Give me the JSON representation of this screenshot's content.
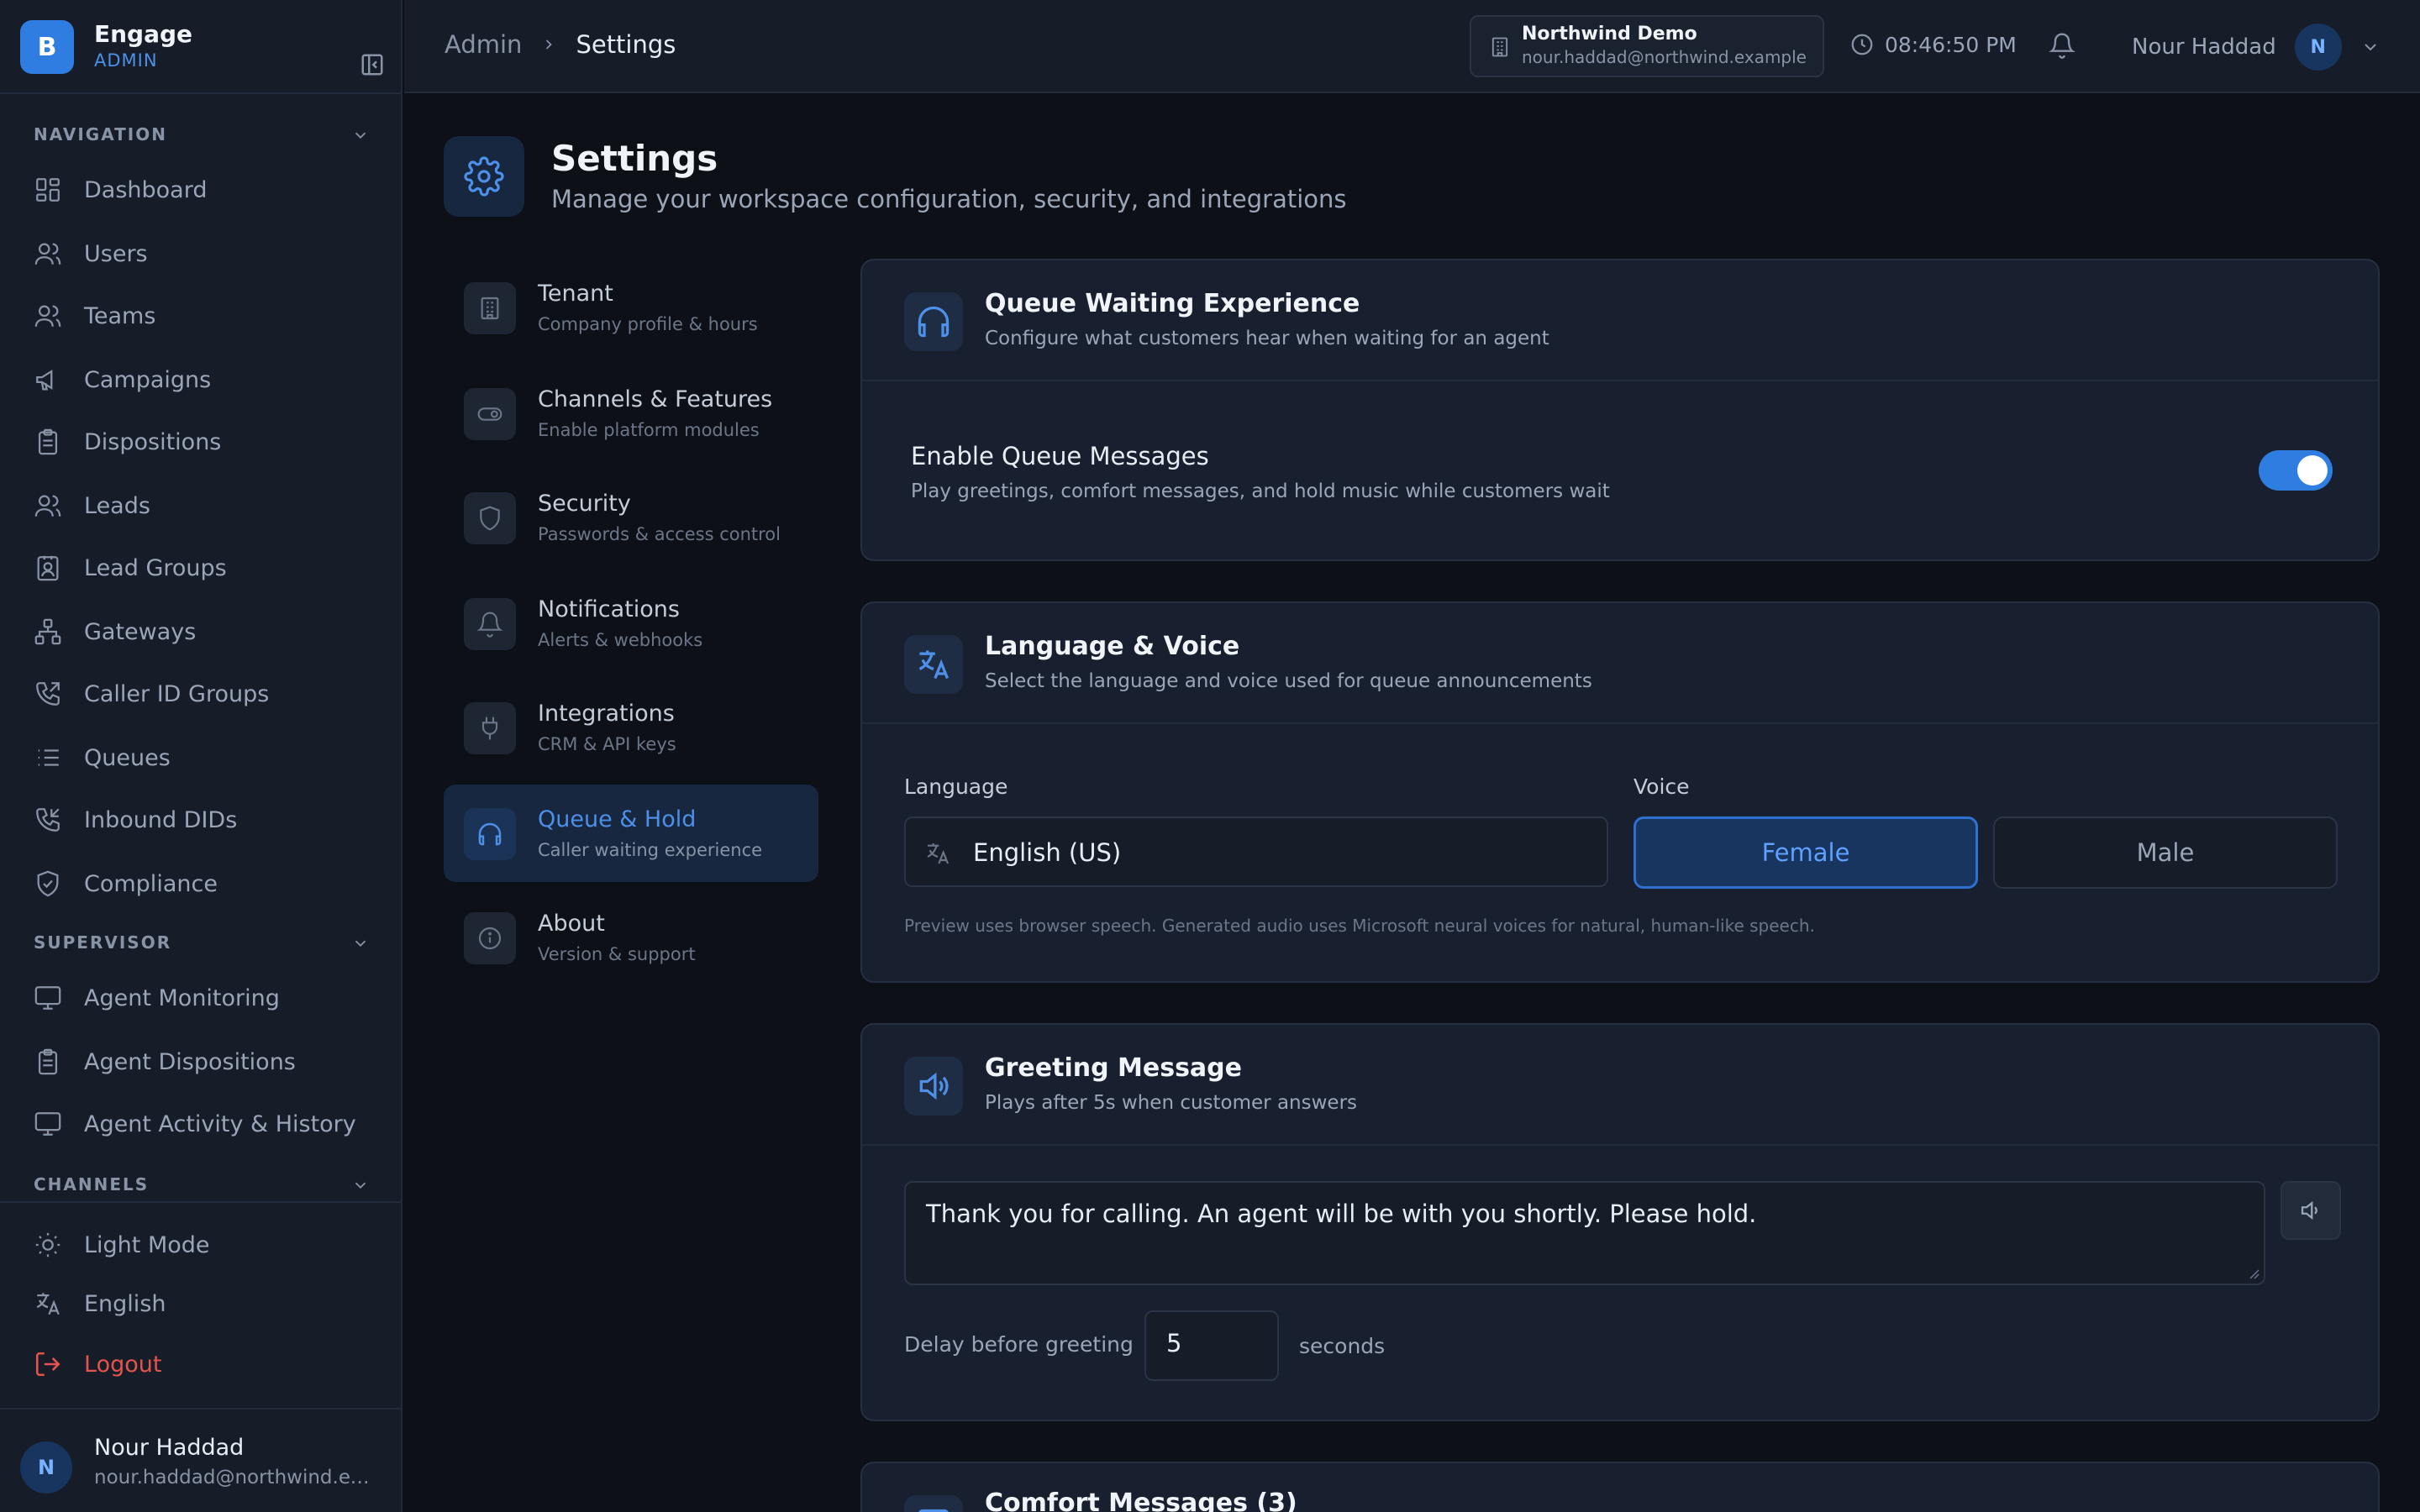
{
  "brand": {
    "logo_letter": "B",
    "name": "Engage",
    "role": "ADMIN"
  },
  "sidebar": {
    "sections": [
      {
        "title": "NAVIGATION",
        "items": [
          {
            "label": "Dashboard",
            "icon": "dashboard-icon"
          },
          {
            "label": "Users",
            "icon": "users-icon"
          },
          {
            "label": "Teams",
            "icon": "teams-icon"
          },
          {
            "label": "Campaigns",
            "icon": "megaphone-icon"
          },
          {
            "label": "Dispositions",
            "icon": "clipboard-icon"
          },
          {
            "label": "Leads",
            "icon": "leads-icon"
          },
          {
            "label": "Lead Groups",
            "icon": "contact-card-icon"
          },
          {
            "label": "Gateways",
            "icon": "network-icon"
          },
          {
            "label": "Caller ID Groups",
            "icon": "phone-forward-icon"
          },
          {
            "label": "Queues",
            "icon": "list-icon"
          },
          {
            "label": "Inbound DIDs",
            "icon": "phone-incoming-icon"
          },
          {
            "label": "Compliance",
            "icon": "shield-check-icon"
          }
        ]
      },
      {
        "title": "SUPERVISOR",
        "items": [
          {
            "label": "Agent Monitoring",
            "icon": "monitor-icon"
          },
          {
            "label": "Agent Dispositions",
            "icon": "clipboard-icon"
          },
          {
            "label": "Agent Activity & History",
            "icon": "monitor-icon"
          }
        ]
      },
      {
        "title": "CHANNELS",
        "items": []
      }
    ],
    "footer_items": [
      {
        "label": "Light Mode",
        "icon": "sun-icon"
      },
      {
        "label": "English",
        "icon": "translate-icon"
      },
      {
        "label": "Logout",
        "icon": "logout-icon"
      }
    ],
    "user": {
      "initial": "N",
      "name": "Nour Haddad",
      "email": "nour.haddad@northwind.example"
    }
  },
  "header": {
    "breadcrumb": [
      "Admin",
      "Settings"
    ],
    "tenant": {
      "name": "Northwind Demo",
      "email": "nour.haddad@northwind.example"
    },
    "time": "08:46:50 PM",
    "user": {
      "name": "Nour Haddad",
      "initial": "N"
    }
  },
  "page": {
    "title": "Settings",
    "subtitle": "Manage your workspace configuration, security, and integrations"
  },
  "settings_nav": [
    {
      "title": "Tenant",
      "sub": "Company profile & hours",
      "icon": "building-icon"
    },
    {
      "title": "Channels & Features",
      "sub": "Enable platform modules",
      "icon": "toggle-icon"
    },
    {
      "title": "Security",
      "sub": "Passwords & access control",
      "icon": "shield-icon"
    },
    {
      "title": "Notifications",
      "sub": "Alerts & webhooks",
      "icon": "bell-icon"
    },
    {
      "title": "Integrations",
      "sub": "CRM & API keys",
      "icon": "plug-icon"
    },
    {
      "title": "Queue & Hold",
      "sub": "Caller waiting experience",
      "icon": "headphones-icon",
      "active": true
    },
    {
      "title": "About",
      "sub": "Version & support",
      "icon": "info-icon"
    }
  ],
  "queue_card": {
    "title": "Queue Waiting Experience",
    "subtitle": "Configure what customers hear when waiting for an agent",
    "toggle_title": "Enable Queue Messages",
    "toggle_sub": "Play greetings, comfort messages, and hold music while customers wait",
    "enabled": true
  },
  "language_card": {
    "title": "Language & Voice",
    "subtitle": "Select the language and voice used for queue announcements",
    "language_label": "Language",
    "language_value": "English (US)",
    "voice_label": "Voice",
    "voices": [
      "Female",
      "Male"
    ],
    "selected_voice": "Female",
    "note": "Preview uses browser speech. Generated audio uses Microsoft neural voices for natural, human-like speech."
  },
  "greeting_card": {
    "title": "Greeting Message",
    "subtitle": "Plays after 5s when customer answers",
    "message": "Thank you for calling. An agent will be with you shortly. Please hold.",
    "delay_label": "Delay before greeting",
    "delay_value": "5",
    "delay_unit": "seconds"
  },
  "comfort_card": {
    "title": "Comfort Messages (3)"
  },
  "colors": {
    "accent": "#2f7de1",
    "danger": "#e5534b",
    "bg": "#0d1117",
    "panel": "#182030"
  }
}
